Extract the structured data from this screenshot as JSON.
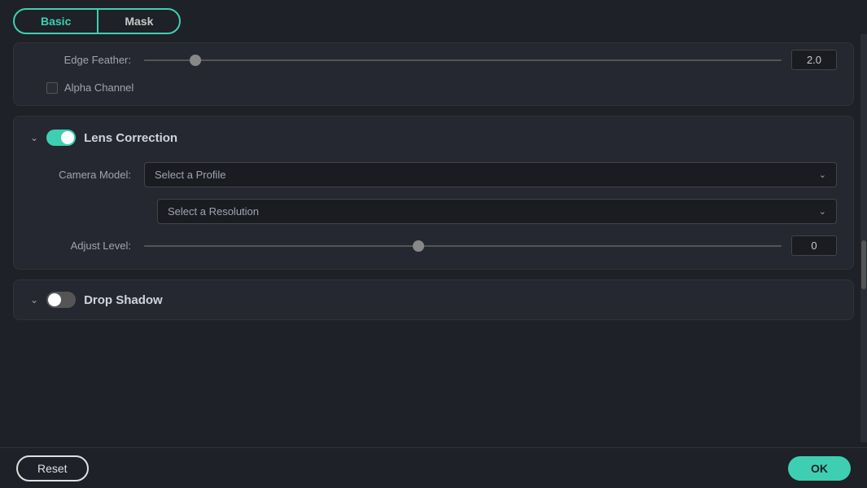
{
  "tabs": {
    "basic_label": "Basic",
    "mask_label": "Mask"
  },
  "top_panel": {
    "edge_feather_label": "Edge Feather:",
    "edge_feather_value": "2.0",
    "edge_feather_percent": 8,
    "alpha_channel_label": "Alpha Channel"
  },
  "lens_correction": {
    "title": "Lens Correction",
    "camera_model_label": "Camera Model:",
    "camera_model_placeholder": "Select a Profile",
    "resolution_placeholder": "Select a Resolution",
    "adjust_level_label": "Adjust Level:",
    "adjust_level_value": "0",
    "adjust_level_percent": 43
  },
  "drop_shadow": {
    "title": "Drop Shadow"
  },
  "bottom_bar": {
    "reset_label": "Reset",
    "ok_label": "OK"
  },
  "icons": {
    "chevron_down": "⌄",
    "chevron_right": "›"
  }
}
